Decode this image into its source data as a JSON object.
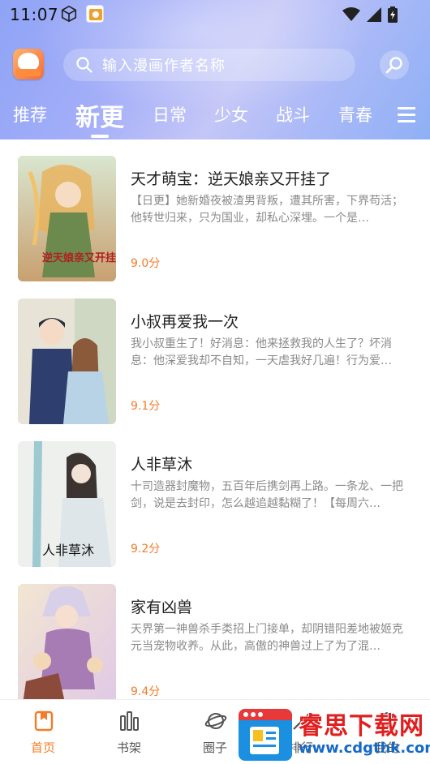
{
  "status_bar": {
    "time": "11:07"
  },
  "search": {
    "placeholder": "输入漫画作者名称"
  },
  "tabs": [
    {
      "label": "推荐"
    },
    {
      "label": "新更"
    },
    {
      "label": "日常"
    },
    {
      "label": "少女"
    },
    {
      "label": "战斗"
    },
    {
      "label": "青春"
    }
  ],
  "active_tab": "新更",
  "comics": [
    {
      "title": "天才萌宝：逆天娘亲又开挂了",
      "desc": "【日更】她新婚夜被渣男背叛，遭其所害，下界苟活；他转世归来，只为国业，却私心深埋。一个是…",
      "score": "9.0分",
      "cover_text": "逆天娘亲又开挂"
    },
    {
      "title": "小叔再爱我一次",
      "desc": "我小叔重生了！好消息：他来拯救我的人生了？坏消息：他深爱我却不自知，一天虐我好几遍！行为爱…",
      "score": "9.1分",
      "cover_text": ""
    },
    {
      "title": "人非草沐",
      "desc": "十司造器封魔物，五百年后携剑再上路。一条龙、一把剑，说是去封印，怎么越追越黏糊了！【每周六…",
      "score": "9.2分",
      "cover_text": "人非草沐"
    },
    {
      "title": "家有凶兽",
      "desc": "天界第一神兽杀手类招上门接单，却阴错阳差地被姬克元当宠物收养。从此，高傲的神兽过上了为了混…",
      "score": "9.4分",
      "cover_text": ""
    }
  ],
  "bottom_nav": [
    {
      "label": "首页",
      "icon": "bookmark-icon"
    },
    {
      "label": "书架",
      "icon": "bars-icon"
    },
    {
      "label": "圈子",
      "icon": "planet-icon"
    },
    {
      "label": "排行",
      "icon": "rank-icon"
    },
    {
      "label": "我的",
      "icon": "user-icon"
    }
  ],
  "watermark": {
    "title": "睿思下载网",
    "url": "www.cdgthk.com"
  },
  "colors": {
    "accent": "#f47b28",
    "header_start": "#8fa3f6",
    "header_end": "#8fb0f5"
  }
}
